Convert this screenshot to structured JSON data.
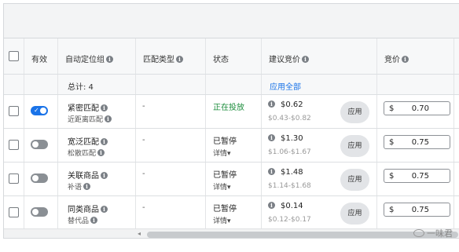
{
  "header": {
    "enabled": "有效",
    "auto_target_group": "自动定位组",
    "match_type": "匹配类型",
    "status": "状态",
    "suggested_bid": "建议竞价",
    "bid": "竞价",
    "extra": "¥"
  },
  "total": {
    "label": "总计: 4",
    "apply_all": "应用全部"
  },
  "rows": [
    {
      "enabled": true,
      "name": "紧密匹配",
      "sub": "近距离匹配",
      "match": "-",
      "status": "正在投放",
      "status_detail": "",
      "suggested": "$0.62",
      "range": "$0.43-$0.82",
      "apply": "应用",
      "currency": "$",
      "bid": "0.70"
    },
    {
      "enabled": false,
      "name": "宽泛匹配",
      "sub": "松散匹配",
      "match": "-",
      "status": "已暂停",
      "status_detail": "详情",
      "suggested": "$1.30",
      "range": "$1.06-$1.67",
      "apply": "应用",
      "currency": "$",
      "bid": "0.75"
    },
    {
      "enabled": false,
      "name": "关联商品",
      "sub": "补语",
      "match": "-",
      "status": "已暂停",
      "status_detail": "详情",
      "suggested": "$1.48",
      "range": "$1.14-$1.68",
      "apply": "应用",
      "currency": "$",
      "bid": "0.75"
    },
    {
      "enabled": false,
      "name": "同类商品",
      "sub": "替代品",
      "match": "-",
      "status": "已暂停",
      "status_detail": "详情",
      "suggested": "$0.14",
      "range": "$0.12-$0.17",
      "apply": "应用",
      "currency": "$",
      "bid": "0.75"
    }
  ],
  "icons": {
    "info": "info-icon",
    "caret": "caret-down-icon",
    "toggle_check": "check-icon"
  },
  "colors": {
    "toggle_on": "#1a73e8",
    "active_status": "#1e8e3e",
    "link": "#1a73e8"
  },
  "watermark": "一味君"
}
